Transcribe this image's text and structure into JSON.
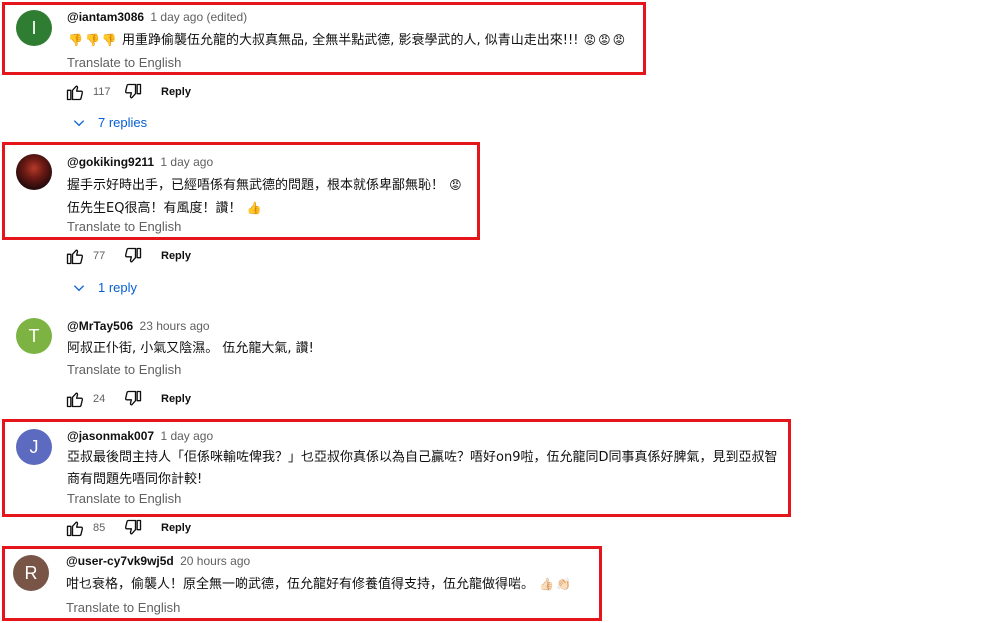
{
  "comments": [
    {
      "avatar_letter": "I",
      "avatar_color": "#2e7d32",
      "handle": "@iantam3086",
      "time": "1 day ago (edited)",
      "lines": [
        "用重踭偷襲伍允龍的大叔真無品, 全無半點武德, 影衰學武的人, 似青山走出來!!!"
      ],
      "prefix_emoji": [
        "thumbs-down",
        "thumbs-down",
        "thumbs-down"
      ],
      "suffix_emoji": [
        "angry",
        "angry",
        "angry"
      ],
      "translate": "Translate to English",
      "likes": "117",
      "reply_label": "Reply",
      "replies_label": "7 replies"
    },
    {
      "avatar_letter": "",
      "avatar_color": "#5a1a14",
      "handle": "@gokiking9211",
      "time": "1 day ago",
      "lines": [
        "握手示好時出手，已經唔係有無武德的問題，根本就係卑鄙無恥！",
        "伍先生EQ很高！有風度！讚！"
      ],
      "translate": "Translate to English",
      "likes": "77",
      "reply_label": "Reply",
      "replies_label": "1 reply"
    },
    {
      "avatar_letter": "T",
      "avatar_color": "#7cb342",
      "handle": "@MrTay506",
      "time": "23 hours ago",
      "lines": [
        "阿叔正仆街, 小氣又陰濕。 伍允龍大氣, 讚!"
      ],
      "translate": "Translate to English",
      "likes": "24",
      "reply_label": "Reply"
    },
    {
      "avatar_letter": "J",
      "avatar_color": "#5c6bc0",
      "handle": "@jasonmak007",
      "time": "1 day ago",
      "lines": [
        "亞叔最後問主持人「佢係咪輸咗俾我？」乜亞叔你真係以為自己贏咗？唔好on9啦，伍允龍同D同事真係好脾氣，見到亞叔智",
        "商有問題先唔同你計較!"
      ],
      "translate": "Translate to English",
      "likes": "85",
      "reply_label": "Reply"
    },
    {
      "avatar_letter": "R",
      "avatar_color": "#795548",
      "handle": "@user-cy7vk9wj5d",
      "time": "20 hours ago",
      "lines": [
        "咁乜衰格，偷襲人！原全無一啲武德，伍允龍好有修養值得支持，伍允龍做得啱。"
      ],
      "translate": "Translate to English"
    }
  ]
}
